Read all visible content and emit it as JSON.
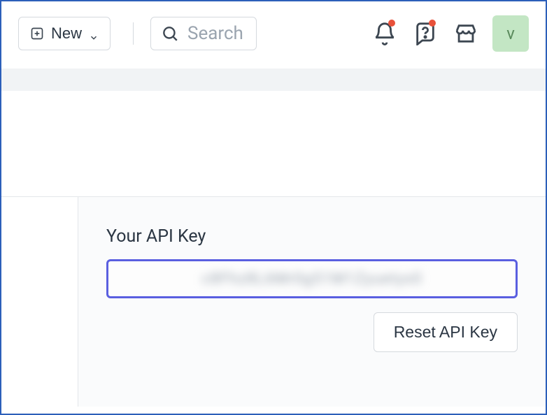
{
  "topbar": {
    "new_label": "New",
    "search_placeholder": "Search",
    "avatar_initial": "v"
  },
  "api": {
    "section_label": "Your API Key",
    "key_value_masked": "c8Fhz8L6Mr0g51M1Zyuetyx0",
    "reset_label": "Reset API Key"
  }
}
